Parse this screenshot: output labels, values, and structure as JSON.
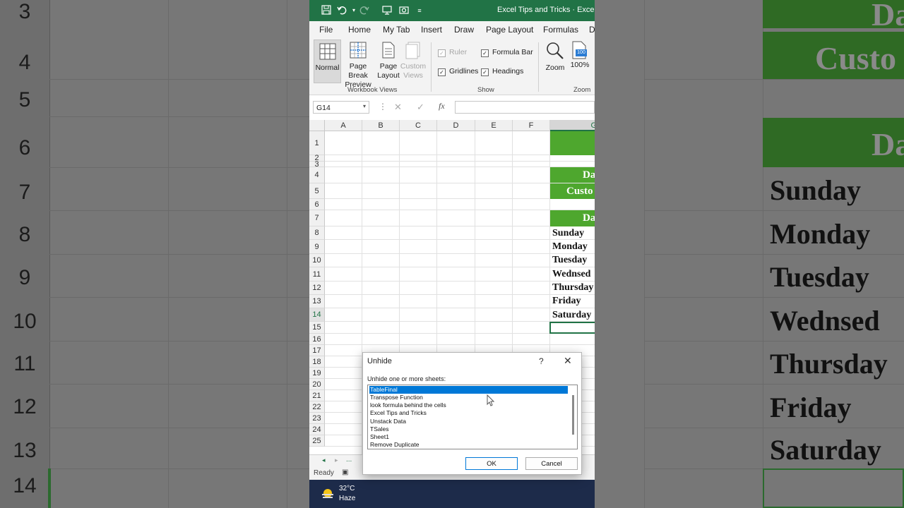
{
  "window": {
    "title": "Excel Tips and Tricks  ·  Excel"
  },
  "quick_access": {
    "icons": [
      "save-icon",
      "undo-icon",
      "redo-icon",
      "present-icon",
      "camera-icon",
      "customize-icon"
    ]
  },
  "menu": [
    "File",
    "Home",
    "My Tab",
    "Insert",
    "Draw",
    "Page Layout",
    "Formulas",
    "D"
  ],
  "ribbon": {
    "workbook_views": {
      "label": "Workbook Views",
      "normal": "Normal",
      "page_break_1": "Page Break",
      "page_break_2": "Preview",
      "page_layout_1": "Page",
      "page_layout_2": "Layout",
      "custom_1": "Custom",
      "custom_2": "Views"
    },
    "show": {
      "label": "Show",
      "ruler": "Ruler",
      "formula_bar": "Formula Bar",
      "gridlines": "Gridlines",
      "headings": "Headings"
    },
    "zoom": {
      "label": "Zoom",
      "zoom": "Zoom",
      "zoom_100": "100%",
      "icon_100": "100"
    }
  },
  "formula_bar": {
    "name_box": "G14",
    "fx": "fx"
  },
  "grid": {
    "columns": [
      "A",
      "B",
      "C",
      "D",
      "E",
      "F",
      "G"
    ],
    "rows": [
      "1",
      "2",
      "3",
      "4",
      "5",
      "6",
      "7",
      "8",
      "9",
      "10",
      "11",
      "12",
      "13",
      "14",
      "15",
      "16",
      "17",
      "18",
      "19",
      "20",
      "21",
      "22",
      "23",
      "24",
      "25"
    ],
    "cells": {
      "g3": "Da",
      "g4": "Custo",
      "g6": "Da",
      "days": [
        "Sunday",
        "Monday",
        "Tuesday",
        "Wednsed",
        "Thursday",
        "Friday",
        "Saturday"
      ]
    }
  },
  "sheet_tabs": {
    "more": "..."
  },
  "status": {
    "ready": "Ready"
  },
  "taskbar": {
    "temp": "32°C",
    "weather": "Haze"
  },
  "dialog": {
    "title": "Unhide",
    "help": "?",
    "instruction": "Unhide one or more sheets:",
    "sheets": [
      "TableFinal",
      "Transpose Function",
      "look formula behind the cells",
      "Excel Tips and Tricks",
      "Unstack Data",
      "TSales",
      "Sheet1",
      "Remove Duplicate"
    ],
    "ok": "OK",
    "cancel": "Cancel"
  },
  "background": {
    "left_rows": [
      "3",
      "4",
      "5",
      "6",
      "7",
      "8",
      "9",
      "10",
      "11",
      "12",
      "13",
      "14"
    ],
    "right_texts": [
      "Da",
      "Custo",
      "Da",
      "Sunday",
      "Monday",
      "Tuesday",
      "Wednsed",
      "Thursday",
      "Friday",
      "Saturday"
    ]
  },
  "colors": {
    "excel_green": "#217346",
    "header_green": "#4ea72e",
    "selection_blue": "#0078d7"
  }
}
